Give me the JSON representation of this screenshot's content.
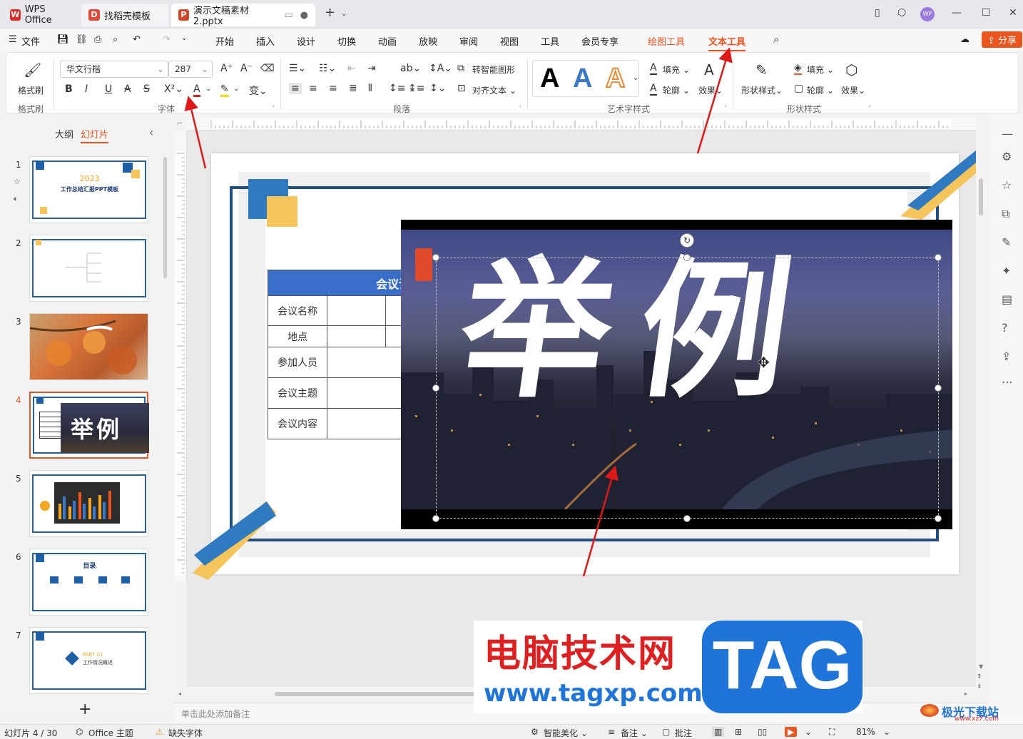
{
  "tabs": [
    {
      "label": "WPS Office",
      "icon": "wps-logo-icon"
    },
    {
      "label": "找稻壳模板",
      "icon": "docer-icon"
    },
    {
      "label": "演示文稿素材2.pptx",
      "icon": "ppt-icon"
    }
  ],
  "menu": [
    "文件",
    "开始",
    "插入",
    "设计",
    "切换",
    "动画",
    "放映",
    "审阅",
    "视图",
    "工具",
    "会员专享",
    "绘图工具",
    "文本工具"
  ],
  "share_label": "分享",
  "ribbon": {
    "format_painter": "格式刷",
    "format_painter_group": "格式刷",
    "font_name": "华文行楷",
    "font_size": "287",
    "font_group": "字体",
    "paragraph_group": "段落",
    "smart_shape": "转智能图形",
    "align_text": "对齐文本",
    "art_group": "艺术字样式",
    "fill": "填充",
    "outline": "轮廓",
    "effect": "效果",
    "shape_style": "形状样式",
    "shape_fill": "填充",
    "shape_outline": "轮廓",
    "shape_effect": "效果",
    "shape_group": "形状样式"
  },
  "panel": {
    "outline_tab": "大纲",
    "slides_tab": "幻灯片"
  },
  "thumbs": [
    {
      "num": "1",
      "year": "2023",
      "title": "工作总结汇报PPT模板"
    },
    {
      "num": "2"
    },
    {
      "num": "3"
    },
    {
      "num": "4"
    },
    {
      "num": "5"
    },
    {
      "num": "6",
      "title": "目录"
    },
    {
      "num": "7",
      "part": "PART 01",
      "sub": "工作情况概述"
    }
  ],
  "slide": {
    "table_title": "会议记",
    "rows": [
      "会议名称",
      "地点",
      "参加人员",
      "会议主题",
      "会议内容"
    ],
    "art_text": "举例"
  },
  "notes_placeholder": "单击此处添加备注",
  "status": {
    "slide_count": "幻灯片 4 / 30",
    "theme": "Office 主题",
    "missing_font": "缺失字体",
    "beautify": "智能美化",
    "notes": "备注",
    "comments": "批注",
    "zoom": "81%"
  },
  "watermark": {
    "title": "电脑技术网",
    "tag": "TAG",
    "url": "www.tagxp.com",
    "corner": "极光下载站",
    "corner_url": "www.xz7.com"
  },
  "colors": {
    "accent": "#e9541f",
    "blue": "#1f5fa5",
    "yellow": "#f5c45a",
    "ppt_red": "#d24726"
  }
}
